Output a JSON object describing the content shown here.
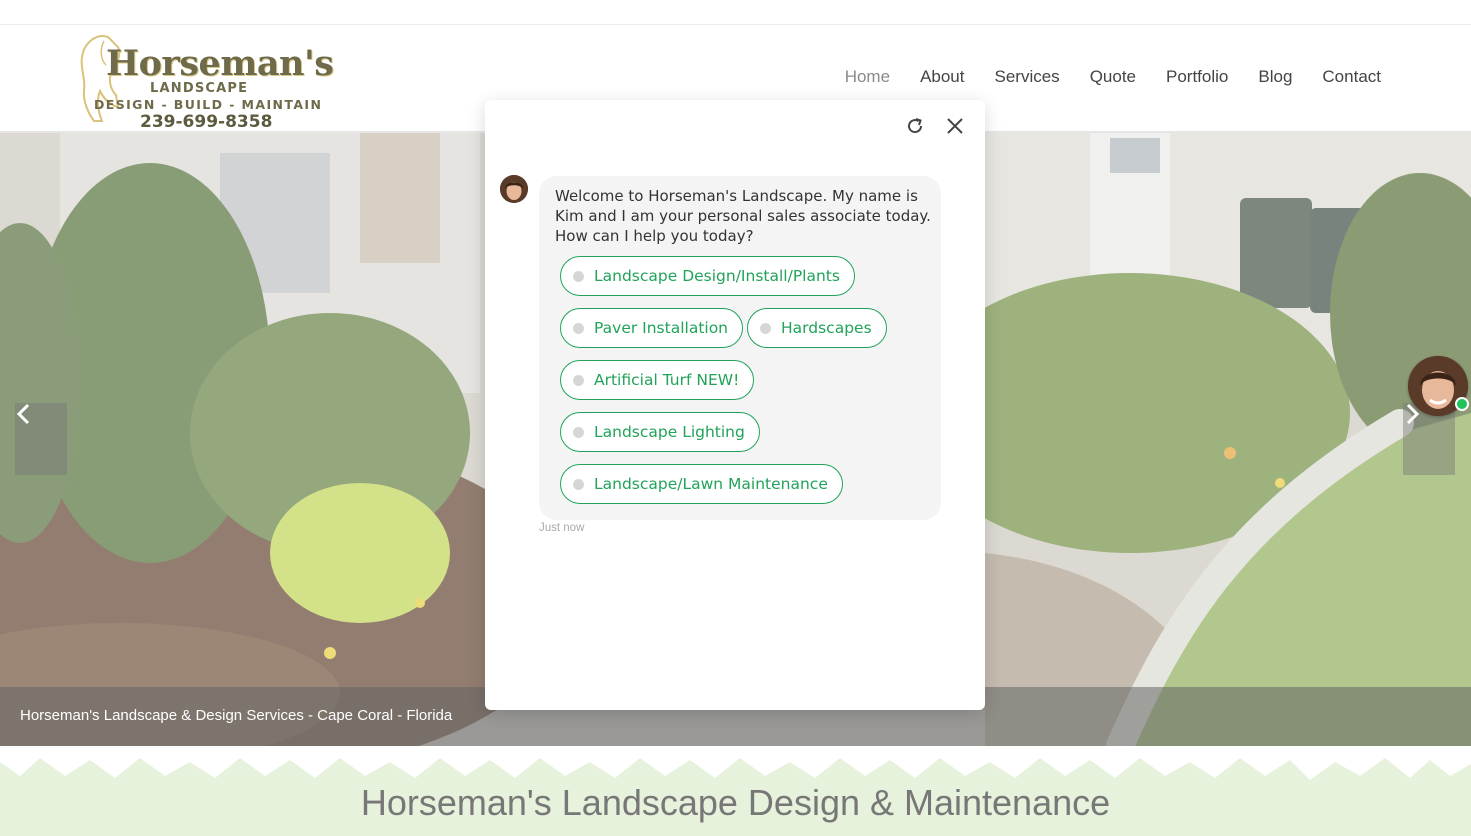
{
  "brand": {
    "name": "Horseman's",
    "subtitle": "LANDSCAPE",
    "tagline": "DESIGN - BUILD - MAINTAIN",
    "phone": "239-699-8358"
  },
  "nav": {
    "items": [
      {
        "label": "Home",
        "active": true
      },
      {
        "label": "About",
        "active": false
      },
      {
        "label": "Services",
        "active": false
      },
      {
        "label": "Quote",
        "active": false
      },
      {
        "label": "Portfolio",
        "active": false
      },
      {
        "label": "Blog",
        "active": false
      },
      {
        "label": "Contact",
        "active": false
      }
    ]
  },
  "hero": {
    "caption": "Horseman's Landscape & Design Services - Cape Coral - Florida",
    "prev_icon": "chevron-left-icon",
    "next_icon": "chevron-right-icon"
  },
  "band": {
    "title": "Horseman's Landscape Design & Maintenance"
  },
  "chat": {
    "refresh_icon": "refresh-icon",
    "close_icon": "close-icon",
    "message": "Welcome to Horseman's Landscape. My name is Kim and I am your personal sales associate today. How can I help you today?",
    "options": [
      "Landscape Design/Install/Plants",
      "Paver Installation",
      "Hardscapes",
      "Artificial Turf NEW!",
      "Landscape Lighting",
      "Landscape/Lawn Maintenance"
    ],
    "timestamp": "Just now",
    "accent_color": "#21a35a",
    "online_color": "#1fc35a"
  }
}
